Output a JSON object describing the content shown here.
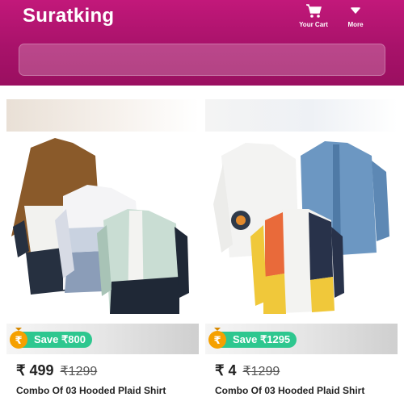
{
  "header": {
    "brand": "Suratking",
    "cart_label": "Your Cart",
    "more_label": "More",
    "search_placeholder": ""
  },
  "products": [
    {
      "save": "Save ₹800",
      "price": "₹ 499",
      "mrp": "₹1299",
      "title": "Combo Of 03 Hooded Plaid Shirt"
    },
    {
      "save": "Save ₹1295",
      "price": "₹ 4",
      "mrp": "₹1299",
      "title": "Combo Of 03 Hooded Plaid Shirt"
    }
  ],
  "colors": {
    "header": "#b3136f",
    "save_badge": "#2ec78f",
    "coin": "#f5a000"
  }
}
